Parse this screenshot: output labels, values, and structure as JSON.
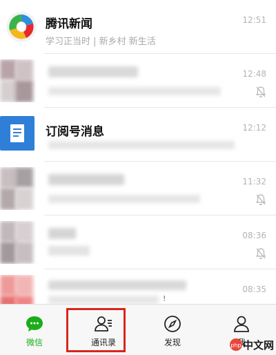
{
  "chats": [
    {
      "title": "腾讯新闻",
      "subtitle": "学习正当时 | 新乡村 新生活",
      "time": "12:51",
      "muted": false
    },
    {
      "title": "",
      "subtitle": "",
      "time": "12:48",
      "muted": true
    },
    {
      "title": "订阅号消息",
      "subtitle": "",
      "time": "12:12",
      "muted": false
    },
    {
      "title": "",
      "subtitle": "",
      "time": "11:32",
      "muted": true
    },
    {
      "title": "",
      "subtitle": "",
      "time": "08:36",
      "muted": true
    },
    {
      "title": "",
      "subtitle": "",
      "time": "08:35",
      "muted": false,
      "extra": "!"
    }
  ],
  "tabbar": {
    "tabs": [
      {
        "label": "微信",
        "icon": "chat-bubble-icon",
        "active": true
      },
      {
        "label": "通讯录",
        "icon": "contacts-icon",
        "active": false
      },
      {
        "label": "发现",
        "icon": "compass-icon",
        "active": false
      },
      {
        "label": "我",
        "icon": "person-icon",
        "active": false
      }
    ]
  },
  "watermark": {
    "text": "中文网",
    "logo_text": "php"
  },
  "colors": {
    "accent": "#1aad19",
    "highlight": "#d9251c",
    "subscription": "#2f7fd8"
  }
}
